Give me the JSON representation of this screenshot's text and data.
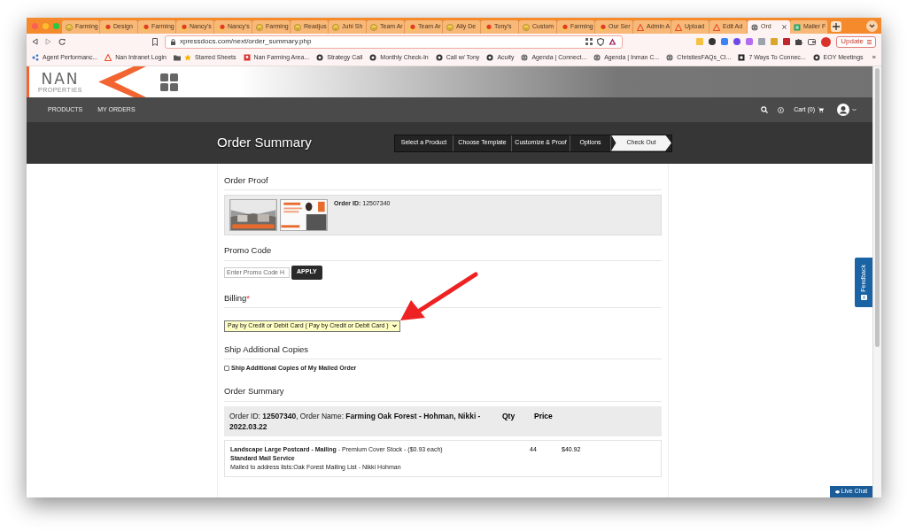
{
  "browser": {
    "tabs": [
      {
        "label": "Farming",
        "kind": "smiley",
        "selected": false
      },
      {
        "label": "Design",
        "kind": "red",
        "selected": false
      },
      {
        "label": "Farming",
        "kind": "red",
        "selected": false
      },
      {
        "label": "Nancy's",
        "kind": "red",
        "selected": false
      },
      {
        "label": "Nancy's",
        "kind": "red",
        "selected": false
      },
      {
        "label": "Farming",
        "kind": "smiley",
        "selected": false
      },
      {
        "label": "Readjus",
        "kind": "smiley",
        "selected": false
      },
      {
        "label": "Juhi Sh",
        "kind": "smiley",
        "selected": false
      },
      {
        "label": "Team Ar",
        "kind": "smiley",
        "selected": false
      },
      {
        "label": "Team Ar",
        "kind": "red",
        "selected": false
      },
      {
        "label": "Ally De",
        "kind": "smiley",
        "selected": false
      },
      {
        "label": "Tony's",
        "kind": "red",
        "selected": false
      },
      {
        "label": "Custom",
        "kind": "smiley",
        "selected": false
      },
      {
        "label": "Farming",
        "kind": "red",
        "selected": false
      },
      {
        "label": "Our Ser",
        "kind": "red",
        "selected": false
      },
      {
        "label": "Admin A",
        "kind": "triangle",
        "selected": false
      },
      {
        "label": "Upload",
        "kind": "triangle",
        "selected": false
      },
      {
        "label": "Edit Ad",
        "kind": "triangle",
        "selected": false
      },
      {
        "label": "Ord",
        "kind": "globe",
        "selected": true
      },
      {
        "label": "Mailer F",
        "kind": "sheet",
        "selected": false
      }
    ],
    "address": "xpressdocs.com/next/order_summary.php",
    "update_button": "Update",
    "bookmarks": [
      {
        "label": "Agent Performanc...",
        "kind": "blue"
      },
      {
        "label": "Nan Intranet Login",
        "kind": "triangle"
      },
      {
        "label": "Starred Sheets",
        "kind": "folder"
      },
      {
        "label": "Nan Farming Area...",
        "kind": "pin"
      },
      {
        "label": "Strategy Call",
        "kind": "dark"
      },
      {
        "label": "Monthly Check-In",
        "kind": "dark"
      },
      {
        "label": "Call w/ Tony",
        "kind": "dark"
      },
      {
        "label": "Acuity",
        "kind": "dark"
      },
      {
        "label": "Agenda | Connect...",
        "kind": "globe"
      },
      {
        "label": "Agenda | Inman C...",
        "kind": "globe"
      },
      {
        "label": "ChristiesFAQs_Cl...",
        "kind": "globe"
      },
      {
        "label": "7 Ways To Connec...",
        "kind": "square"
      },
      {
        "label": "EOY Meetings",
        "kind": "dark"
      }
    ],
    "more_bookmarks": "»"
  },
  "site": {
    "logo": {
      "name": "NAN",
      "sub": "PROPERTIES"
    },
    "nav": [
      "PRODUCTS",
      "MY ORDERS"
    ],
    "cart": "Cart (0)",
    "page_title": "Order Summary",
    "steps": [
      {
        "label": "Select a Product",
        "selected": false
      },
      {
        "label": "Choose Template",
        "selected": false
      },
      {
        "label": "Customize & Proof",
        "selected": false
      },
      {
        "label": "Options",
        "selected": false
      },
      {
        "label": "Check Out",
        "selected": true
      }
    ],
    "order_proof": {
      "heading": "Order Proof",
      "order_id": "**Order ID:** 12507340"
    },
    "promo": {
      "heading": "Promo Code",
      "placeholder": "Enter Promo Code H",
      "button": "APPLY"
    },
    "billing": {
      "heading": "Billing",
      "required_mark": "*",
      "value": "Pay by Credit or Debit Card ( Pay by Credit or Debit Card )"
    },
    "ship_copies": {
      "heading": "Ship Additional Copies",
      "label": "Ship Additional Copies of My Mailed Order",
      "checked": false
    },
    "order_summary": {
      "heading": "Order Summary",
      "header": "Order ID: **12507340**, Order Name: **Farming Oak Forest - Hohman, Nikki - 2022.03.22**",
      "columns": [
        "Qty",
        "Price"
      ],
      "rows": [
        {
          "product": "**Landscape Large Postcard - Mailing** - Premium Cover Stock - ($0.93 each)",
          "service": "Standard Mail Service",
          "lists": "Mailed to address lists:Oak Forest Mailing List - Nikki Hohman",
          "qty": "44",
          "price": "$40.92"
        }
      ]
    },
    "feedback": "Feedback",
    "live_chat": "Live Chat"
  }
}
